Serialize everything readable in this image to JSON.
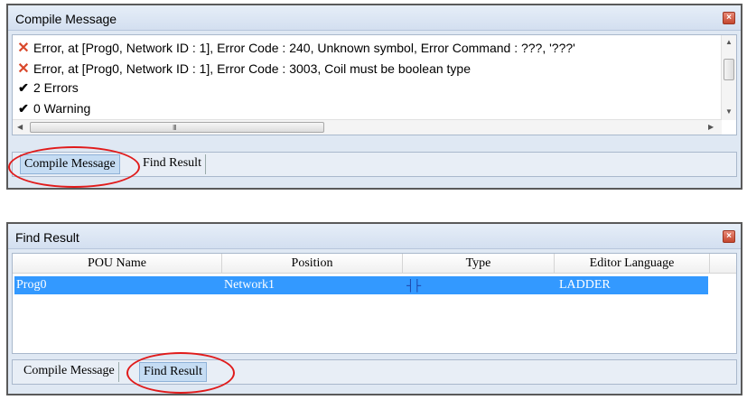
{
  "compile_panel": {
    "title": "Compile Message",
    "close_label": "×",
    "messages": [
      {
        "icon": "error-icon",
        "glyph": "✕",
        "text": "Error, at [Prog0, Network ID : 1], Error Code : 240, Unknown symbol, Error Command : ???, '???'"
      },
      {
        "icon": "error-icon",
        "glyph": "✕",
        "text": "Error, at [Prog0, Network ID : 1], Error Code : 3003, Coil must be boolean type"
      },
      {
        "icon": "check-icon",
        "glyph": "✔",
        "text": "2 Errors"
      },
      {
        "icon": "check-icon",
        "glyph": "✔",
        "text": "0 Warning"
      }
    ],
    "scroll_grip": "III",
    "tabs": {
      "compile": "Compile Message",
      "find": "Find Result"
    }
  },
  "find_panel": {
    "title": "Find Result",
    "close_label": "×",
    "columns": [
      "POU Name",
      "Position",
      "Type",
      "Editor Language"
    ],
    "rows": [
      {
        "pou": "Prog0",
        "position": "Network1",
        "type_icon": "contact-icon",
        "type_glyph": "┤├",
        "language": "LADDER"
      }
    ],
    "tabs": {
      "compile": "Compile Message",
      "find": "Find Result"
    }
  },
  "colors": {
    "error": "#d9482b",
    "selection": "#3399ff",
    "highlight_circle": "#e01b1b"
  }
}
